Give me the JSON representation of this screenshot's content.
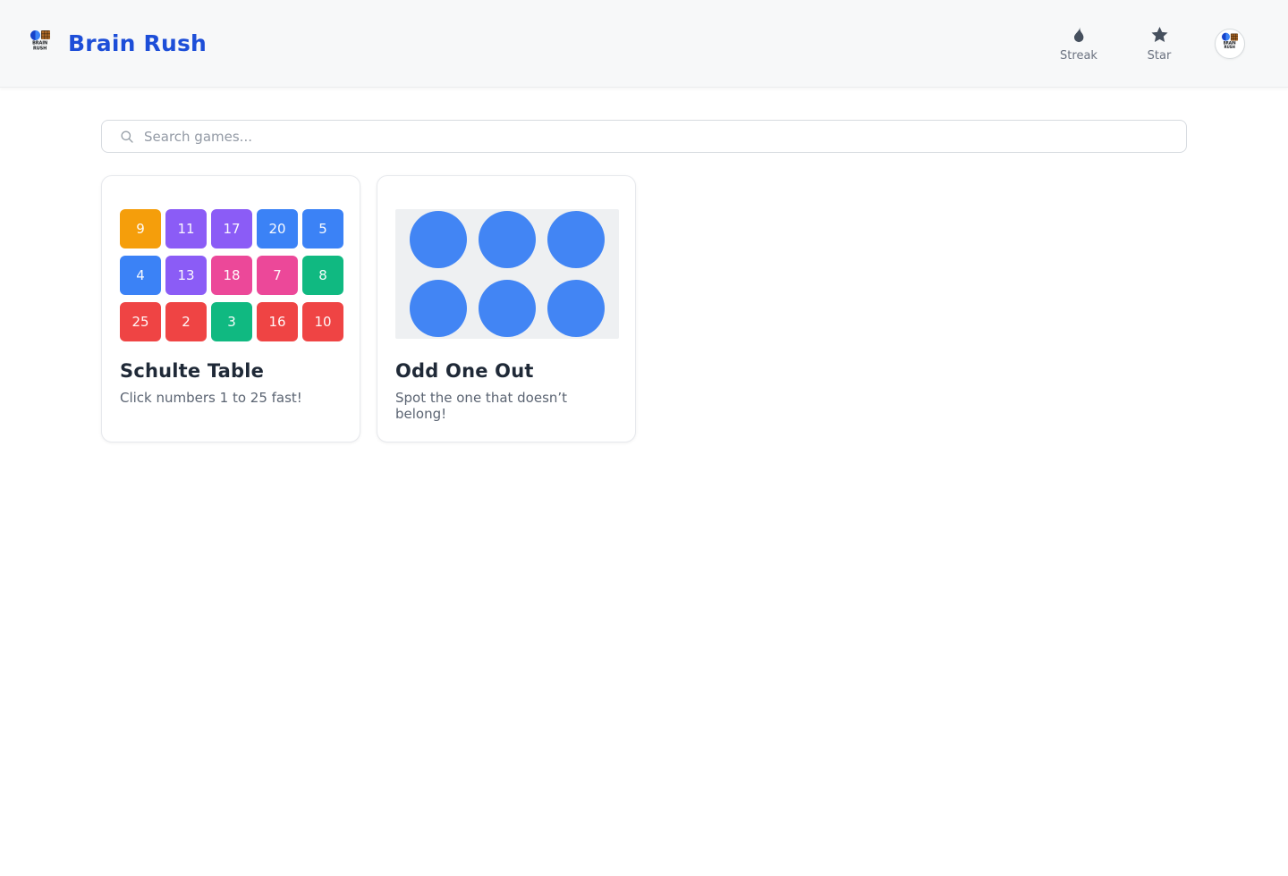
{
  "header": {
    "title": "Brain Rush",
    "logo": {
      "line1": "BRAIN",
      "line2": "RUSH",
      "icon": "brain-rush-logo"
    },
    "actions": {
      "streak": {
        "label": "Streak",
        "icon": "flame-icon"
      },
      "star": {
        "label": "Star",
        "icon": "star-icon"
      }
    },
    "avatar": {
      "icon": "brain-rush-logo-avatar"
    }
  },
  "search": {
    "placeholder": "Search games...",
    "icon": "search-icon"
  },
  "cards": [
    {
      "id": "schulte-table",
      "title": "Schulte Table",
      "subtitle": "Click numbers 1 to 25 fast!",
      "preview": {
        "type": "number-tile-grid",
        "columns": 5,
        "tiles": [
          {
            "value": "9",
            "color": "#f59e0b"
          },
          {
            "value": "11",
            "color": "#8b5cf6"
          },
          {
            "value": "17",
            "color": "#8b5cf6"
          },
          {
            "value": "20",
            "color": "#3b82f6"
          },
          {
            "value": "5",
            "color": "#3b82f6"
          },
          {
            "value": "4",
            "color": "#3b82f6"
          },
          {
            "value": "13",
            "color": "#8b5cf6"
          },
          {
            "value": "18",
            "color": "#ec4899"
          },
          {
            "value": "7",
            "color": "#ec4899"
          },
          {
            "value": "8",
            "color": "#10b981"
          },
          {
            "value": "25",
            "color": "#ef4444"
          },
          {
            "value": "2",
            "color": "#ef4444"
          },
          {
            "value": "3",
            "color": "#10b981"
          },
          {
            "value": "16",
            "color": "#ef4444"
          },
          {
            "value": "10",
            "color": "#ef4444"
          }
        ]
      }
    },
    {
      "id": "odd-one-out",
      "title": "Odd One Out",
      "subtitle": "Spot the one that doesn’t belong!",
      "preview": {
        "type": "circle-grid",
        "columns": 3,
        "rows": 2,
        "count": 6,
        "circle_color": "#4285f4",
        "background": "#eef0f2"
      }
    }
  ],
  "colors": {
    "brand_blue": "#1d4ed8",
    "header_background": "#f7f8f9",
    "icon_slate": "#46505e",
    "label_gray": "#6b7280"
  }
}
